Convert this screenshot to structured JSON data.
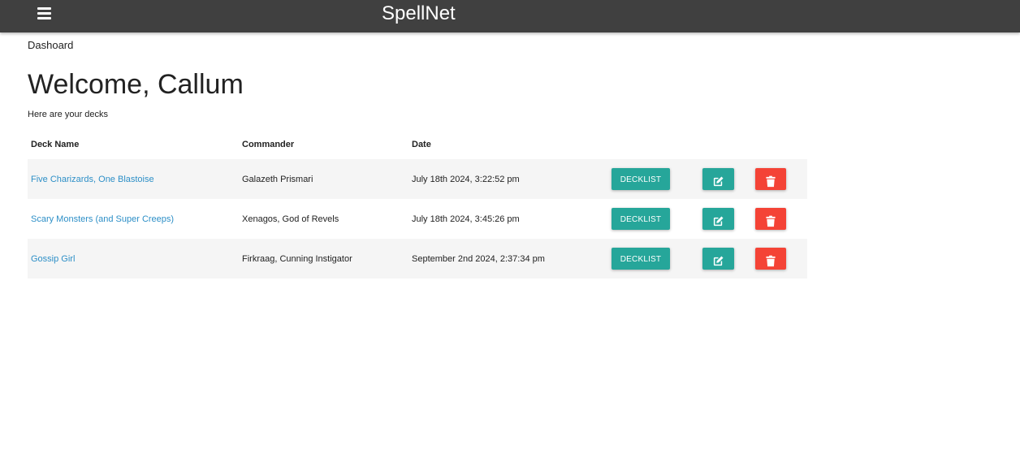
{
  "header": {
    "brand": "SpellNet",
    "menu_icon": "hamburger-menu-icon"
  },
  "breadcrumb": "Dashoard",
  "page": {
    "title": "Welcome, Callum",
    "subtitle": "Here are your decks"
  },
  "table": {
    "headers": [
      "Deck Name",
      "Commander",
      "Date"
    ],
    "rows": [
      {
        "name": "Five Charizards, One Blastoise",
        "commander": "Galazeth Prismari",
        "date": "July 18th 2024, 3:22:52 pm",
        "decklist_label": "DECKLIST"
      },
      {
        "name": "Scary Monsters (and Super Creeps)",
        "commander": "Xenagos, God of Revels",
        "date": "July 18th 2024, 3:45:26 pm",
        "decklist_label": "DECKLIST"
      },
      {
        "name": "Gossip Girl",
        "commander": "Firkraag, Cunning Instigator",
        "date": "September 2nd 2024, 2:37:34 pm",
        "decklist_label": "DECKLIST"
      }
    ],
    "edit_icon": "edit-icon",
    "delete_icon": "trash-icon"
  },
  "colors": {
    "navbar": "#404040",
    "accent": "#26a69a",
    "danger": "#f44336",
    "link": "#2d8fc7"
  }
}
